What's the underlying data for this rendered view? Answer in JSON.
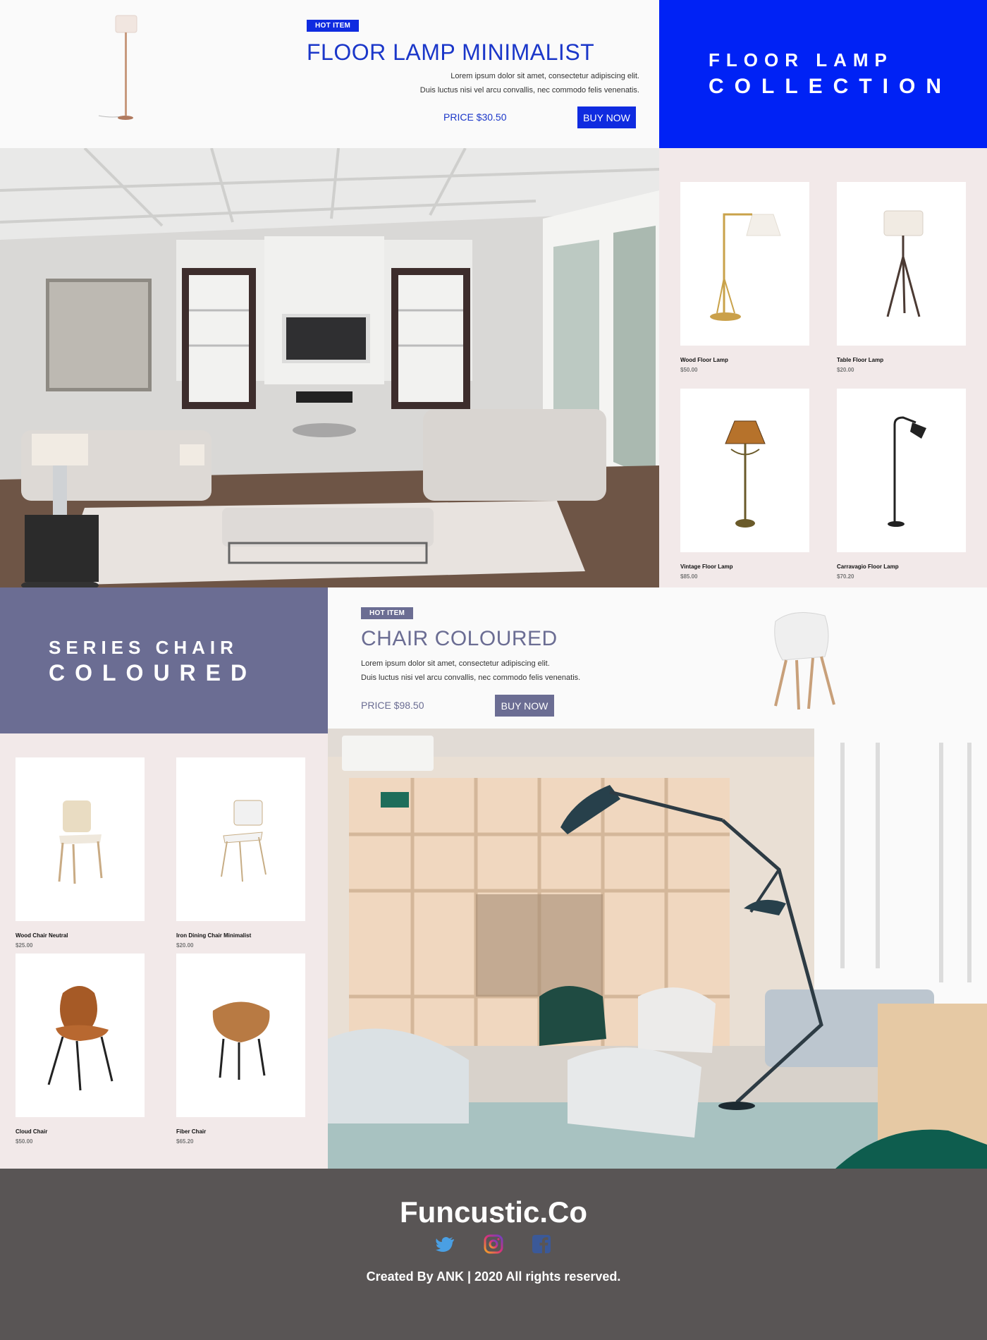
{
  "lamp_hero": {
    "badge": "HOT ITEM",
    "title": "FLOOR LAMP MINIMALIST",
    "desc_line1": "Lorem ipsum dolor sit amet, consectetur adipiscing elit.",
    "desc_line2": "Duis luctus nisi vel arcu convallis, nec commodo felis venenatis.",
    "price": "PRICE $30.50",
    "buy_label": "BUY NOW"
  },
  "lamp_banner": {
    "line1": "FLOOR LAMP",
    "line2": "COLLECTION"
  },
  "lamp_products": [
    {
      "name": "Wood Floor Lamp",
      "price": "$50.00"
    },
    {
      "name": "Table Floor Lamp",
      "price": "$20.00"
    },
    {
      "name": "Vintage Floor Lamp",
      "price": "$85.00"
    },
    {
      "name": "Carravagio Floor Lamp",
      "price": "$70.20"
    }
  ],
  "chair_banner": {
    "line1": "SERIES CHAIR",
    "line2": "COLOURED"
  },
  "chair_hero": {
    "badge": "HOT ITEM",
    "title": "CHAIR COLOURED",
    "desc_line1": "Lorem ipsum dolor sit amet, consectetur adipiscing elit.",
    "desc_line2": "Duis luctus nisi vel arcu convallis, nec commodo felis venenatis.",
    "price": "PRICE $98.50",
    "buy_label": "BUY NOW"
  },
  "chair_products": [
    {
      "name": "Wood Chair Neutral",
      "price": "$25.00"
    },
    {
      "name": "Iron Dining Chair Minimalist",
      "price": "$20.00"
    },
    {
      "name": "Cloud Chair",
      "price": "$50.00"
    },
    {
      "name": "Fiber Chair",
      "price": "$65.20"
    }
  ],
  "footer": {
    "brand": "Funcustic.Co",
    "copyright": "Created By ANK |  2020 All rights reserved.",
    "social": [
      "twitter-icon",
      "instagram-icon",
      "facebook-icon"
    ]
  },
  "colors": {
    "lamp_accent": "#0f2be0",
    "chair_accent": "#6b6d93",
    "grid_bg": "#f2e9e9",
    "footer_bg": "#595555"
  }
}
